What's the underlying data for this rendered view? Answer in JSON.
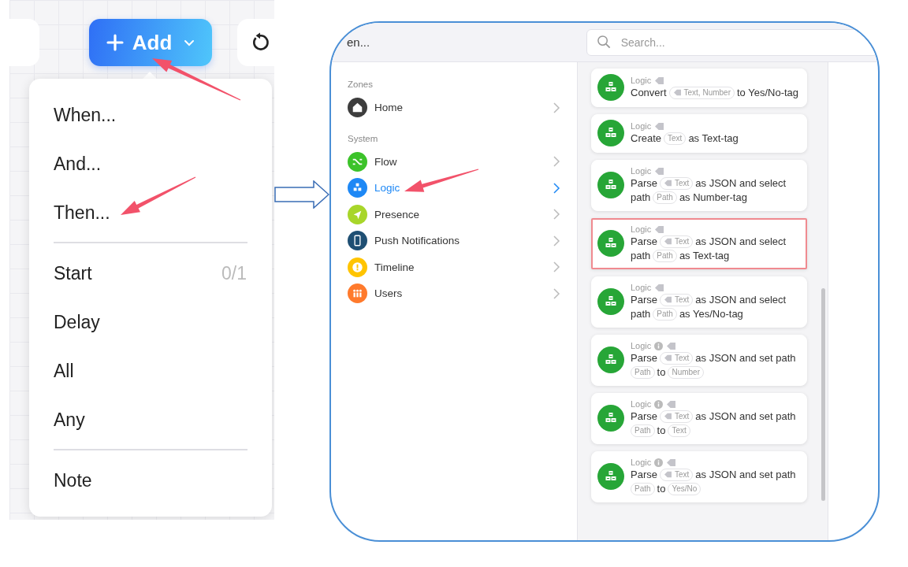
{
  "canvas": {
    "add_button": {
      "label": "Add"
    },
    "menu": {
      "groups": [
        {
          "items": [
            {
              "label": "When..."
            },
            {
              "label": "And..."
            },
            {
              "label": "Then..."
            }
          ]
        },
        {
          "items": [
            {
              "label": "Start",
              "count": "0/1"
            },
            {
              "label": "Delay"
            },
            {
              "label": "All"
            },
            {
              "label": "Any"
            }
          ]
        },
        {
          "items": [
            {
              "label": "Note"
            }
          ]
        }
      ]
    }
  },
  "dialog": {
    "title": "en...",
    "search": {
      "placeholder": "Search..."
    },
    "sections": [
      {
        "heading": "Zones",
        "items": [
          {
            "label": "Home",
            "kind": "home",
            "color": "#3d3d3d",
            "selected": false
          }
        ]
      },
      {
        "heading": "System",
        "items": [
          {
            "label": "Flow",
            "kind": "flow",
            "color": "#3cc32a",
            "selected": false
          },
          {
            "label": "Logic",
            "kind": "logic",
            "color": "#1e88f5",
            "selected": true
          },
          {
            "label": "Presence",
            "kind": "presence",
            "color": "#a8d62a",
            "selected": false
          },
          {
            "label": "Push Notifications",
            "kind": "phone",
            "color": "#1f4f73",
            "selected": false
          },
          {
            "label": "Timeline",
            "kind": "timeline",
            "color": "#ffc400",
            "selected": false
          },
          {
            "label": "Users",
            "kind": "users",
            "color": "#ff7a2c",
            "selected": false
          }
        ]
      }
    ],
    "cards": [
      {
        "category": "Logic",
        "info": false,
        "highlighted": false,
        "parts": [
          {
            "kind": "text",
            "text": "Convert"
          },
          {
            "kind": "token",
            "text": "Text, Number",
            "tag": true
          },
          {
            "kind": "text",
            "text": "to Yes/No-tag"
          }
        ]
      },
      {
        "category": "Logic",
        "info": false,
        "highlighted": false,
        "parts": [
          {
            "kind": "text",
            "text": "Create"
          },
          {
            "kind": "token",
            "text": "Text",
            "tag": false
          },
          {
            "kind": "text",
            "text": "as Text-tag"
          }
        ]
      },
      {
        "category": "Logic",
        "info": false,
        "highlighted": false,
        "parts": [
          {
            "kind": "text",
            "text": "Parse"
          },
          {
            "kind": "token",
            "text": "Text",
            "tag": true
          },
          {
            "kind": "text",
            "text": "as JSON and select"
          },
          {
            "kind": "text",
            "text": "path"
          },
          {
            "kind": "token",
            "text": "Path",
            "tag": false
          },
          {
            "kind": "text",
            "text": "as Number-tag"
          }
        ]
      },
      {
        "category": "Logic",
        "info": false,
        "highlighted": true,
        "parts": [
          {
            "kind": "text",
            "text": "Parse"
          },
          {
            "kind": "token",
            "text": "Text",
            "tag": true
          },
          {
            "kind": "text",
            "text": "as JSON and select"
          },
          {
            "kind": "text",
            "text": "path"
          },
          {
            "kind": "token",
            "text": "Path",
            "tag": false
          },
          {
            "kind": "text",
            "text": "as Text-tag"
          }
        ]
      },
      {
        "category": "Logic",
        "info": false,
        "highlighted": false,
        "parts": [
          {
            "kind": "text",
            "text": "Parse"
          },
          {
            "kind": "token",
            "text": "Text",
            "tag": true
          },
          {
            "kind": "text",
            "text": "as JSON and select"
          },
          {
            "kind": "text",
            "text": "path"
          },
          {
            "kind": "token",
            "text": "Path",
            "tag": false
          },
          {
            "kind": "text",
            "text": "as Yes/No-tag"
          }
        ]
      },
      {
        "category": "Logic",
        "info": true,
        "highlighted": false,
        "parts": [
          {
            "kind": "text",
            "text": "Parse"
          },
          {
            "kind": "token",
            "text": "Text",
            "tag": true
          },
          {
            "kind": "text",
            "text": "as JSON and set path"
          },
          {
            "kind": "token",
            "text": "Path",
            "tag": false
          },
          {
            "kind": "text",
            "text": "to"
          },
          {
            "kind": "token",
            "text": "Number",
            "tag": false
          }
        ]
      },
      {
        "category": "Logic",
        "info": true,
        "highlighted": false,
        "parts": [
          {
            "kind": "text",
            "text": "Parse"
          },
          {
            "kind": "token",
            "text": "Text",
            "tag": true
          },
          {
            "kind": "text",
            "text": "as JSON and set path"
          },
          {
            "kind": "token",
            "text": "Path",
            "tag": false
          },
          {
            "kind": "text",
            "text": "to"
          },
          {
            "kind": "token",
            "text": "Text",
            "tag": false
          }
        ]
      },
      {
        "category": "Logic",
        "info": true,
        "highlighted": false,
        "parts": [
          {
            "kind": "text",
            "text": "Parse"
          },
          {
            "kind": "token",
            "text": "Text",
            "tag": true
          },
          {
            "kind": "text",
            "text": "as JSON and set path"
          },
          {
            "kind": "token",
            "text": "Path",
            "tag": false
          },
          {
            "kind": "text",
            "text": "to"
          },
          {
            "kind": "token",
            "text": "Yes/No",
            "tag": false
          }
        ]
      }
    ]
  }
}
